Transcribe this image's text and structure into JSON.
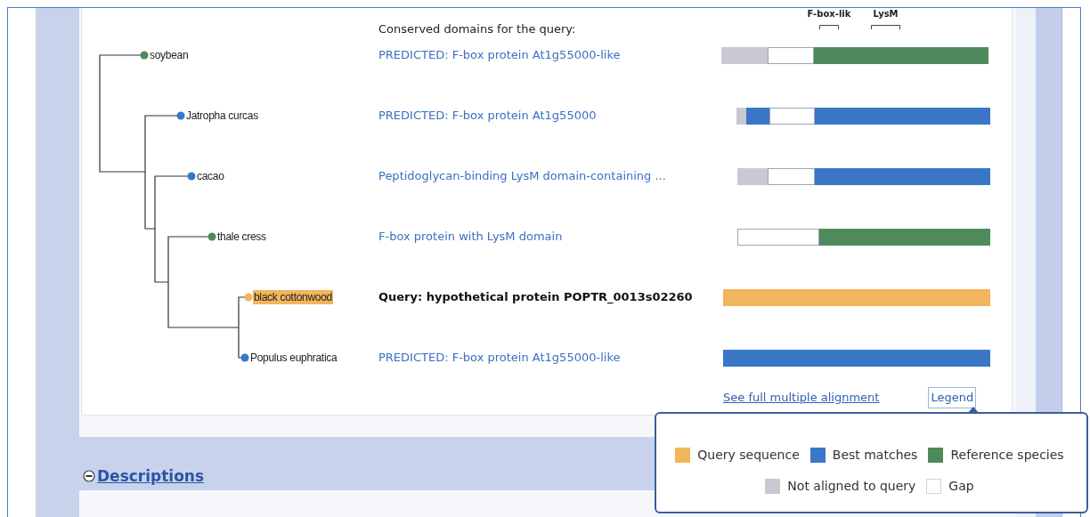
{
  "heading": "Conserved domains for the query:",
  "domains": [
    {
      "label": "F-box-lik"
    },
    {
      "label": "LysM"
    }
  ],
  "rows": [
    {
      "species": "soybean",
      "kind": "reference",
      "title": "PREDICTED: F-box protein At1g55000-like"
    },
    {
      "species": "Jatropha curcas",
      "kind": "best",
      "title": "PREDICTED: F-box protein At1g55000"
    },
    {
      "species": "cacao",
      "kind": "best",
      "title": "Peptidoglycan-binding LysM domain-containing ..."
    },
    {
      "species": "thale cress",
      "kind": "reference",
      "title": "F-box protein with LysM domain"
    },
    {
      "species": "black cottonwood",
      "kind": "query",
      "title": "Query: hypothetical protein POPTR_0013s02260"
    },
    {
      "species": "Populus euphratica",
      "kind": "best",
      "title": "PREDICTED: F-box protein At1g55000-like"
    }
  ],
  "alignment_link": "See full multiple alignment",
  "legend_button": "Legend",
  "legend": [
    {
      "kind": "query",
      "label": "Query sequence"
    },
    {
      "kind": "best",
      "label": "Best matches"
    },
    {
      "kind": "reference",
      "label": "Reference species"
    },
    {
      "kind": "not_aligned",
      "label": "Not aligned to query"
    },
    {
      "kind": "gap",
      "label": "Gap"
    }
  ],
  "section": {
    "title": "Descriptions",
    "expanded": true
  }
}
